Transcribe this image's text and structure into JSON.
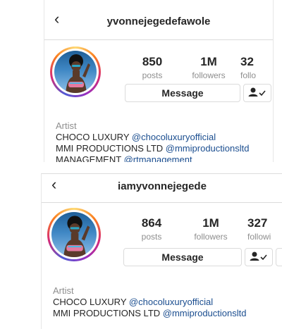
{
  "profiles": [
    {
      "username": "yvonnejegedefawole",
      "stats": [
        {
          "value": "850",
          "label": "posts"
        },
        {
          "value": "1M",
          "label": "followers"
        },
        {
          "value": "32",
          "label": "follo"
        }
      ],
      "message_button": "Message",
      "bio": {
        "category": "Artist",
        "line1_name": "CHOCO LUXURY",
        "line1_handle": "@chocoluxuryofficial",
        "line2_name": "MMI PRODUCTIONS LTD",
        "line2_handle": "@mmiproductionsltd",
        "line3_name": "MANAGEMENT",
        "line3_handle": "@rtmanagement"
      }
    },
    {
      "username": "iamyvonnejegede",
      "stats": [
        {
          "value": "864",
          "label": "posts"
        },
        {
          "value": "1M",
          "label": "followers"
        },
        {
          "value": "327",
          "label": "followi"
        }
      ],
      "message_button": "Message",
      "bio": {
        "category": "Artist",
        "line1_name": "CHOCO LUXURY",
        "line1_handle": "@chocoluxuryofficial",
        "line2_name": "MMI PRODUCTIONS LTD",
        "line2_handle": "@mmiproductionsltd"
      }
    }
  ],
  "colors": {
    "mention": "#1a4d8f",
    "secondary_text": "#8e8e8e",
    "border": "#dbdbdb"
  },
  "icons": {
    "back": "chevron-left-icon",
    "following": "person-check-icon"
  }
}
